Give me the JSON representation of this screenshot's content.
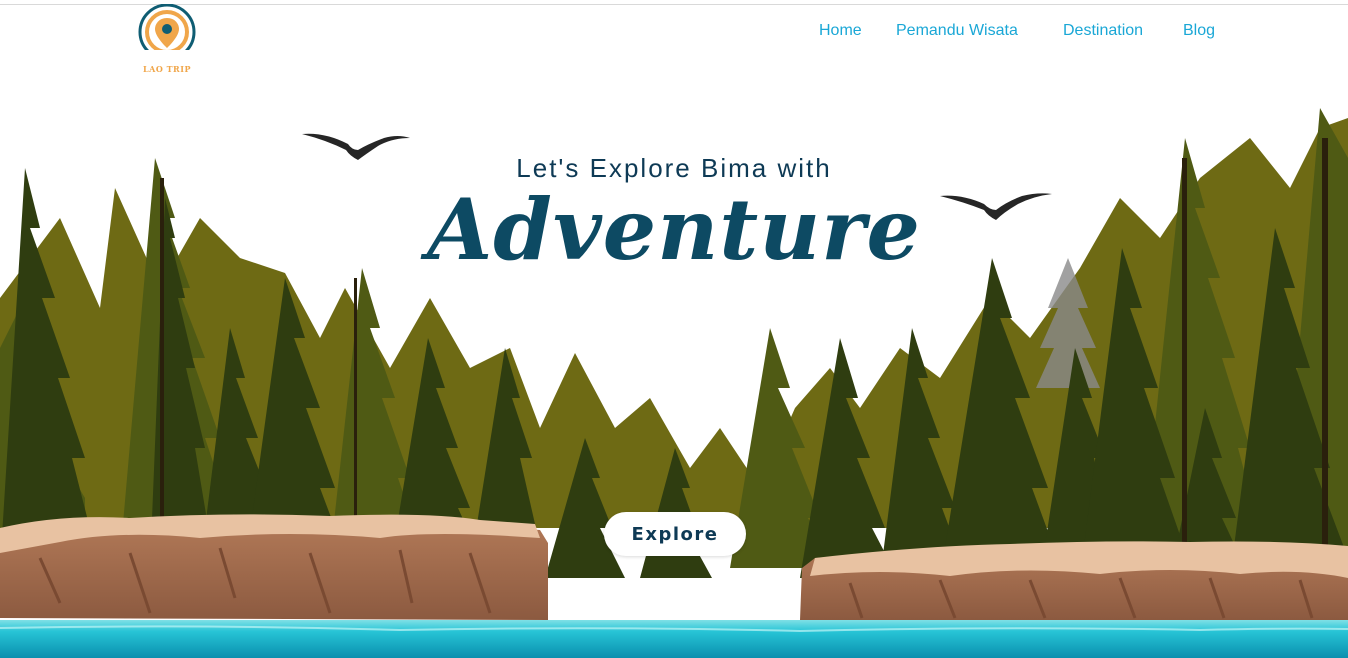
{
  "logo": {
    "text": "LAO TRIP",
    "icon": "compass-pin-logo"
  },
  "nav": {
    "items": [
      {
        "label": "Home"
      },
      {
        "label": "Pemandu Wisata"
      },
      {
        "label": "Destination"
      },
      {
        "label": "Blog"
      }
    ]
  },
  "hero": {
    "subtitle": "Let's Explore Bima with",
    "title": "Adventure",
    "button_label": "Explore"
  },
  "colors": {
    "nav_link": "#1aa7d6",
    "heading": "#0e3a55",
    "far_trees": "#6e6a14",
    "dark_trees": "#2f3d10",
    "cliff": "#e8c2a2",
    "water": "#27c4d6"
  }
}
